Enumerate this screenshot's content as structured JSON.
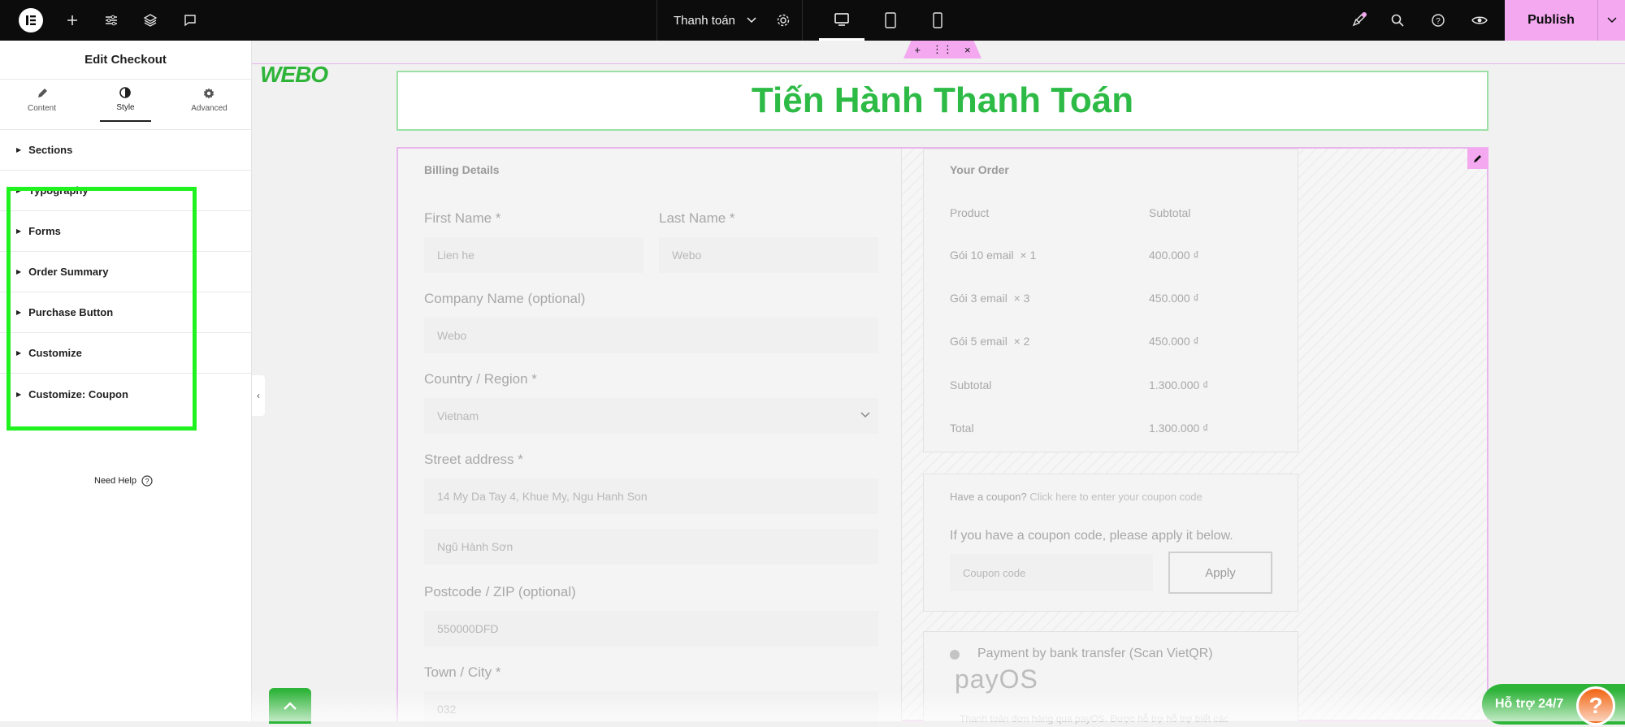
{
  "topbar": {
    "page_name": "Thanh toán",
    "publish_label": "Publish"
  },
  "panel": {
    "title": "Edit Checkout",
    "tabs": [
      {
        "label": "Content",
        "icon": "pencil-icon"
      },
      {
        "label": "Style",
        "icon": "contrast-icon"
      },
      {
        "label": "Advanced",
        "icon": "gear-icon"
      }
    ],
    "sections": [
      "Sections",
      "Typography",
      "Forms",
      "Order Summary",
      "Purchase Button",
      "Customize",
      "Customize: Coupon"
    ],
    "need_help": "Need Help"
  },
  "canvas": {
    "brand": "WEBO",
    "heading": "Tiến Hành Thanh Toán",
    "billing": {
      "title": "Billing Details",
      "first_name_label": "First Name *",
      "first_name_value": "Lien he",
      "last_name_label": "Last Name *",
      "last_name_value": "Webo",
      "company_label": "Company Name (optional)",
      "company_value": "Webo",
      "country_label": "Country / Region *",
      "country_value": "Vietnam",
      "street_label": "Street address *",
      "street_value_1": "14 My Da Tay 4, Khue My, Ngu Hanh Son",
      "street_value_2": "Ngũ Hành Sơn",
      "postcode_label": "Postcode / ZIP (optional)",
      "postcode_value": "550000DFD",
      "city_label": "Town / City *",
      "city_value": "032"
    },
    "order": {
      "title": "Your Order",
      "col_product": "Product",
      "col_subtotal": "Subtotal",
      "items": [
        {
          "name": "Gói 10 email",
          "qty": "× 1",
          "price": "400.000 ₫"
        },
        {
          "name": "Gói 3 email",
          "qty": "× 3",
          "price": "450.000 ₫"
        },
        {
          "name": "Gói 5 email",
          "qty": "× 2",
          "price": "450.000 ₫"
        }
      ],
      "subtotal_label": "Subtotal",
      "subtotal_value": "1.300.000 ₫",
      "total_label": "Total",
      "total_value": "1.300.000 ₫"
    },
    "coupon": {
      "prompt": "Have a coupon?",
      "link": "Click here to enter your coupon code",
      "info": "If you have a coupon code, please apply it below.",
      "placeholder": "Coupon code",
      "apply_label": "Apply"
    },
    "payment": {
      "method": "Payment by bank transfer (Scan VietQR)",
      "brand": "payOS",
      "note": "Thanh toán đơn hàng qua payOS. Được hỗ trợ hỗ trợ biết các"
    },
    "support_label": "Hỗ trợ 24/7",
    "support_q": "?"
  }
}
